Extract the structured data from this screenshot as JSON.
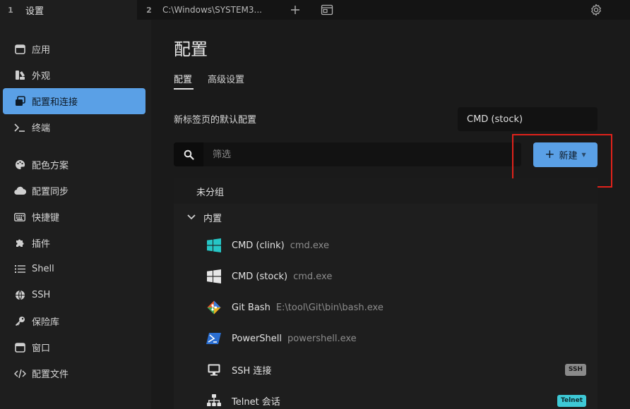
{
  "tabs": [
    {
      "number": "1",
      "title": "设置"
    },
    {
      "number": "2",
      "title": "C:\\Windows\\SYSTEM3..."
    }
  ],
  "toolbar": {
    "new_tab_icon": "plus-icon",
    "window_icon": "window-icon",
    "settings_icon": "gear-icon"
  },
  "sidebar": {
    "items": [
      {
        "label": "应用",
        "icon": "app-window-icon"
      },
      {
        "label": "外观",
        "icon": "paint-icon"
      },
      {
        "label": "配置和连接",
        "icon": "profiles-icon",
        "active": true
      },
      {
        "label": "终端",
        "icon": "terminal-icon"
      },
      {
        "label": "配色方案",
        "icon": "palette-icon"
      },
      {
        "label": "配置同步",
        "icon": "cloud-icon"
      },
      {
        "label": "快捷键",
        "icon": "keyboard-icon"
      },
      {
        "label": "插件",
        "icon": "puzzle-icon"
      },
      {
        "label": "Shell",
        "icon": "list-icon"
      },
      {
        "label": "SSH",
        "icon": "globe-icon"
      },
      {
        "label": "保险库",
        "icon": "key-icon"
      },
      {
        "label": "窗口",
        "icon": "window-icon"
      },
      {
        "label": "配置文件",
        "icon": "code-icon"
      }
    ]
  },
  "main": {
    "title": "配置",
    "subtabs": [
      "配置",
      "高级设置"
    ],
    "default_profile_label": "新标签页的默认配置",
    "default_profile_value": "CMD (stock)",
    "filter_placeholder": "筛选",
    "new_button_label": "新建",
    "groups": {
      "ungrouped": "未分组",
      "builtin": "内置"
    },
    "profiles": [
      {
        "name": "CMD (clink)",
        "command": "cmd.exe",
        "icon": "windows-logo-icon",
        "icon_color": "#26c6c6"
      },
      {
        "name": "CMD (stock)",
        "command": "cmd.exe",
        "icon": "windows-logo-icon",
        "icon_color": "#e6e6e6"
      },
      {
        "name": "Git Bash",
        "command": "E:\\tool\\Git\\bin\\bash.exe",
        "icon": "git-icon"
      },
      {
        "name": "PowerShell",
        "command": "powershell.exe",
        "icon": "powershell-icon"
      },
      {
        "name": "SSH 连接",
        "command": "",
        "icon": "monitor-icon",
        "badge": "SSH",
        "badge_bg": "#8a8a8a",
        "badge_fg": "#1a1a1a"
      },
      {
        "name": "Telnet 会话",
        "command": "",
        "icon": "network-icon",
        "badge": "Telnet",
        "badge_bg": "#3ec9d6",
        "badge_fg": "#0e2a2e"
      }
    ]
  },
  "colors": {
    "accent": "#5aa0e6",
    "highlight": "#e0221b"
  }
}
